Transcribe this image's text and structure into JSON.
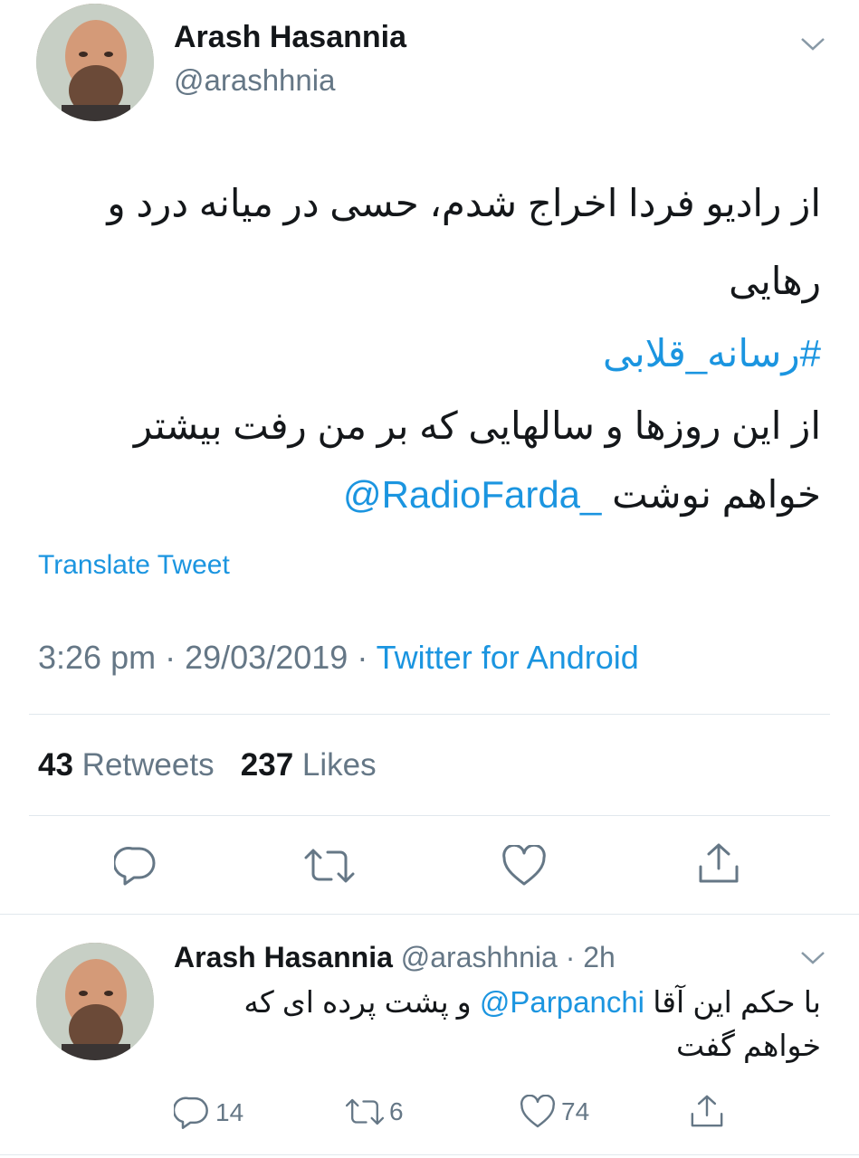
{
  "tweet": {
    "author_name": "Arash Hasannia",
    "author_handle": "@arashhnia",
    "text_line1": "از رادیو فردا اخراج شدم، حسی در میانه درد و",
    "text_line2": "رهایی",
    "hashtag": "#رسانه_قلابی",
    "text_line3": "از این روزها و سالهایی که بر من رفت بیشتر",
    "text_line4_prefix": "خواهم نوشت",
    "mention": "@RadioFarda_",
    "translate_label": "Translate Tweet",
    "time": "3:26 pm",
    "date": "29/03/2019",
    "dot": "·",
    "source": "Twitter for Android",
    "retweets_count": "43",
    "retweets_label": "Retweets",
    "likes_count": "237",
    "likes_label": "Likes"
  },
  "reply": {
    "author_name": "Arash Hasannia",
    "author_handle": "@arashhnia",
    "time_ago": "· 2h",
    "text_prefix": "با حکم این آقا",
    "mention": "@Parpanchi",
    "text_suffix": "و پشت پرده ای که",
    "text_line2": "خواهم گفت",
    "reply_count": "14",
    "retweet_count": "6",
    "like_count": "74"
  },
  "icons": {
    "chevron": "chevron-down-icon",
    "reply": "reply-icon",
    "retweet": "retweet-icon",
    "like": "heart-icon",
    "share": "share-icon"
  },
  "colors": {
    "link": "#1b95e0",
    "secondary": "#657786",
    "divider": "#e1e8ed"
  }
}
